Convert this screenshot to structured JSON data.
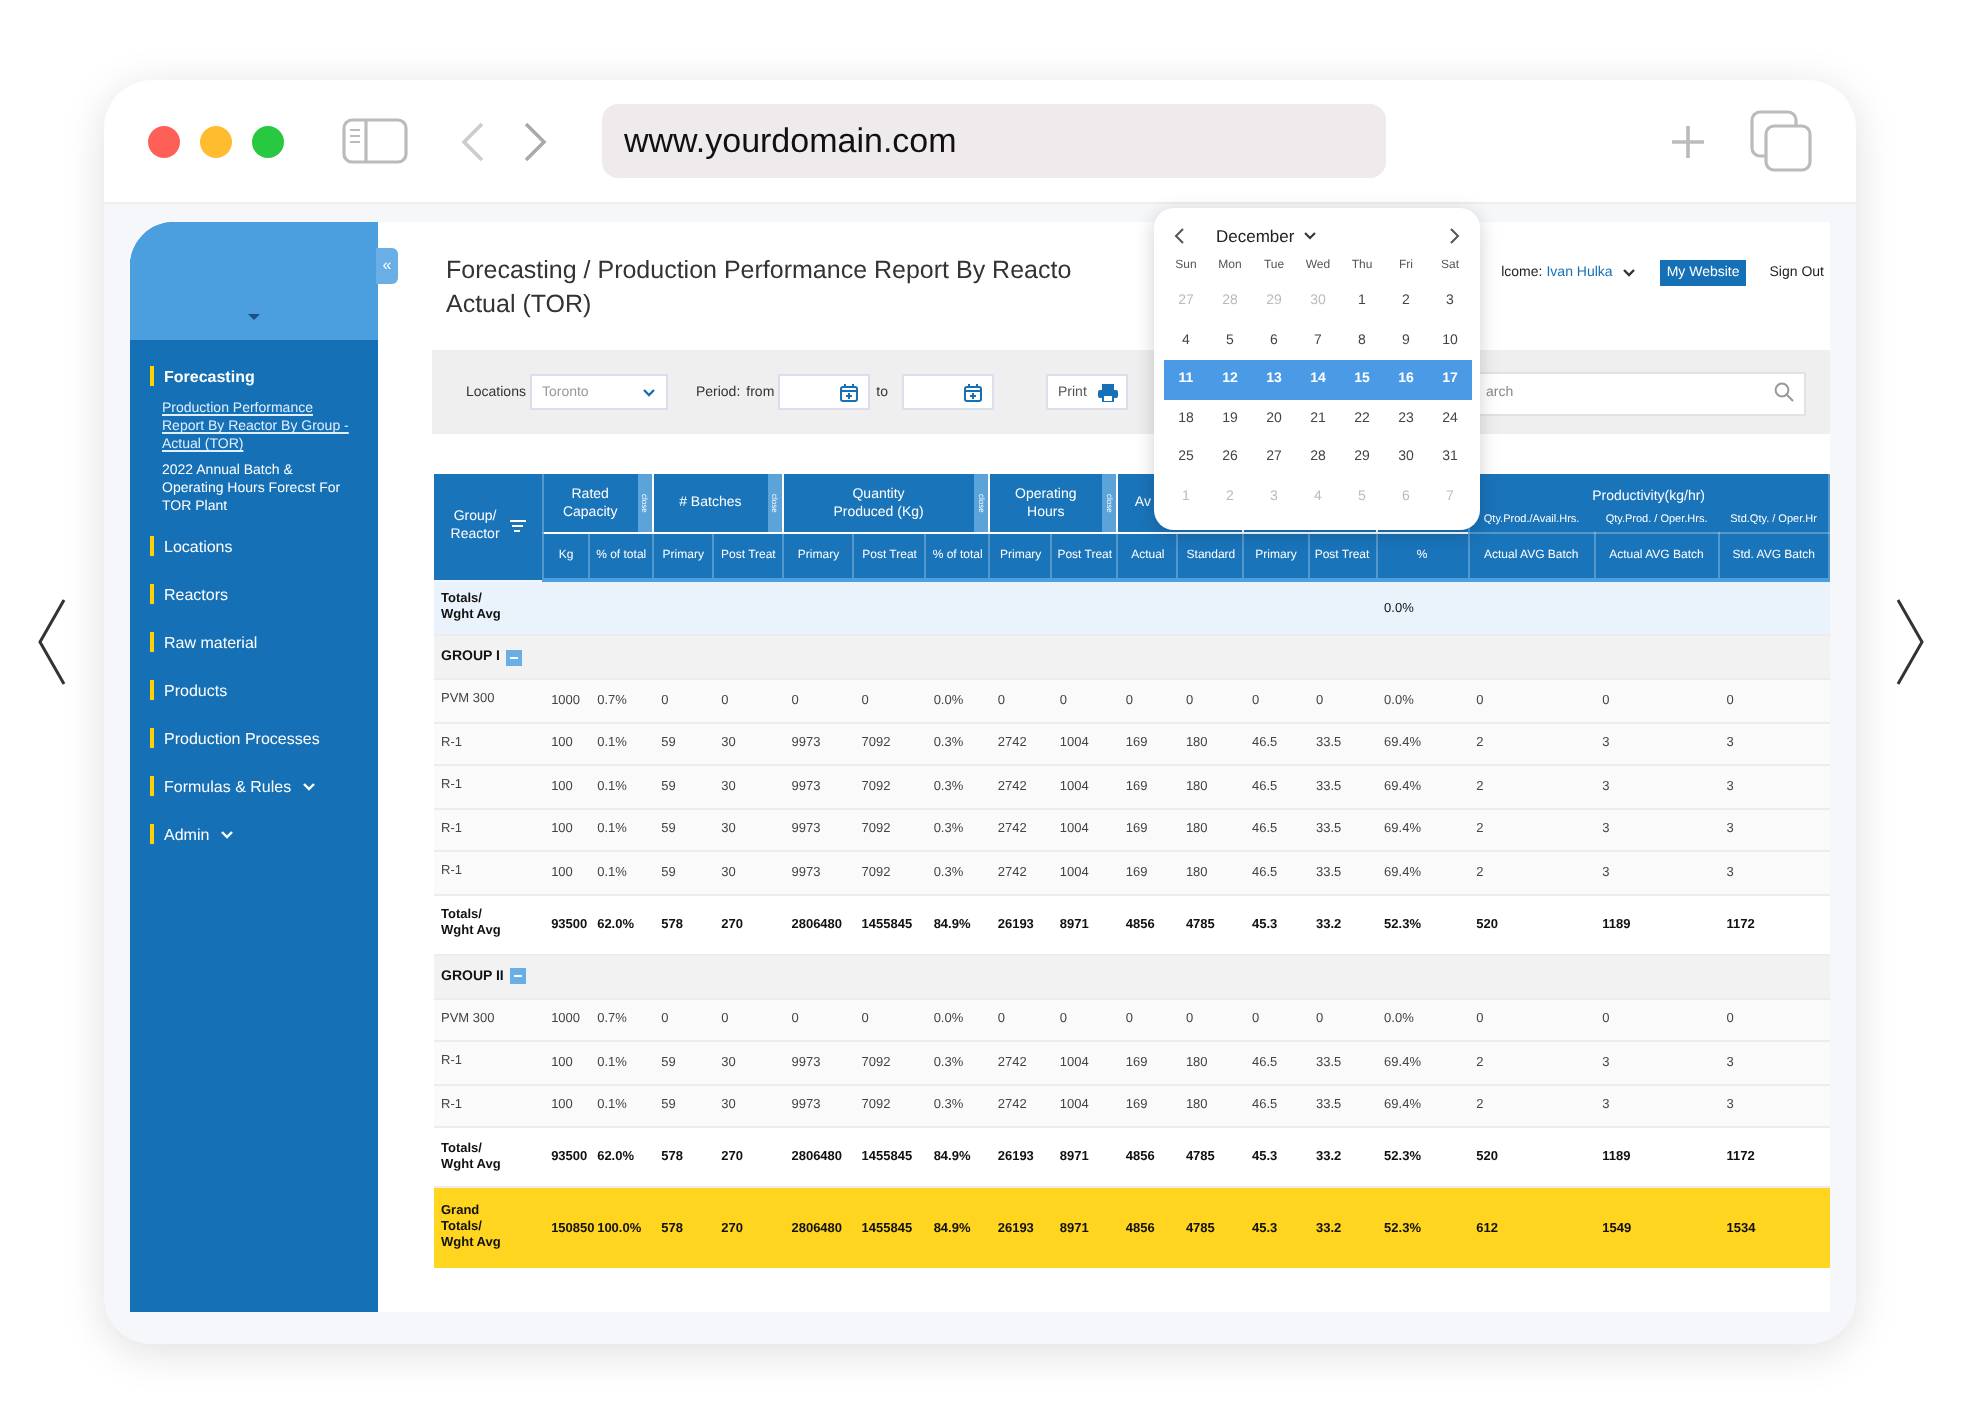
{
  "browser": {
    "url": "www.yourdomain.com"
  },
  "sidebar": {
    "items": [
      {
        "label": "Forecasting",
        "active": true,
        "children": [
          {
            "label": "Production Performance Report By Reactor By Group - Actual (TOR)",
            "selected": true
          },
          {
            "label": "2022 Annual Batch & Operating Hours Forecst For TOR Plant",
            "selected": false
          }
        ]
      },
      {
        "label": "Locations",
        "active": false
      },
      {
        "label": "Reactors",
        "active": false
      },
      {
        "label": "Raw material",
        "active": false
      },
      {
        "label": "Products",
        "active": false
      },
      {
        "label": "Production Processes",
        "active": false
      },
      {
        "label": "Formulas & Rules",
        "active": false,
        "has_menu": true
      },
      {
        "label": "Admin",
        "active": false,
        "has_menu": true
      }
    ]
  },
  "collapse_button": "«",
  "header": {
    "title_lines": [
      "Forecasting / Production Performance Report By Reacto",
      "Actual (TOR)"
    ],
    "welcome_label": "lcome:",
    "user": "Ivan Hulka",
    "my_website": "My Website",
    "sign_out": "Sign Out"
  },
  "toolbar": {
    "location_label": "Locations",
    "location_value": "Toronto",
    "period_label": "Period:",
    "from_label": "from",
    "to_label": "to",
    "print": "Print",
    "search": {
      "placeholder": "arch"
    }
  },
  "calendar": {
    "month": "December",
    "weekdays": [
      "Sun",
      "Mon",
      "Tue",
      "Wed",
      "Thu",
      "Fri",
      "Sat"
    ],
    "weeks": [
      [
        {
          "day": "27",
          "in_month": false,
          "selected": false
        },
        {
          "day": "28",
          "in_month": false,
          "selected": false
        },
        {
          "day": "29",
          "in_month": false,
          "selected": false
        },
        {
          "day": "30",
          "in_month": false,
          "selected": false
        },
        {
          "day": "1",
          "in_month": true,
          "selected": false
        },
        {
          "day": "2",
          "in_month": true,
          "selected": false
        },
        {
          "day": "3",
          "in_month": true,
          "selected": false
        }
      ],
      [
        {
          "day": "4",
          "in_month": true,
          "selected": false
        },
        {
          "day": "5",
          "in_month": true,
          "selected": false
        },
        {
          "day": "6",
          "in_month": true,
          "selected": false
        },
        {
          "day": "7",
          "in_month": true,
          "selected": false
        },
        {
          "day": "8",
          "in_month": true,
          "selected": false
        },
        {
          "day": "9",
          "in_month": true,
          "selected": false
        },
        {
          "day": "10",
          "in_month": true,
          "selected": false
        }
      ],
      [
        {
          "day": "11",
          "in_month": true,
          "selected": true
        },
        {
          "day": "12",
          "in_month": true,
          "selected": true
        },
        {
          "day": "13",
          "in_month": true,
          "selected": true
        },
        {
          "day": "14",
          "in_month": true,
          "selected": true
        },
        {
          "day": "15",
          "in_month": true,
          "selected": true
        },
        {
          "day": "16",
          "in_month": true,
          "selected": true
        },
        {
          "day": "17",
          "in_month": true,
          "selected": true
        }
      ],
      [
        {
          "day": "18",
          "in_month": true,
          "selected": false
        },
        {
          "day": "19",
          "in_month": true,
          "selected": false
        },
        {
          "day": "20",
          "in_month": true,
          "selected": false
        },
        {
          "day": "21",
          "in_month": true,
          "selected": false
        },
        {
          "day": "22",
          "in_month": true,
          "selected": false
        },
        {
          "day": "23",
          "in_month": true,
          "selected": false
        },
        {
          "day": "24",
          "in_month": true,
          "selected": false
        }
      ],
      [
        {
          "day": "25",
          "in_month": true,
          "selected": false
        },
        {
          "day": "26",
          "in_month": true,
          "selected": false
        },
        {
          "day": "27",
          "in_month": true,
          "selected": false
        },
        {
          "day": "28",
          "in_month": true,
          "selected": false
        },
        {
          "day": "29",
          "in_month": true,
          "selected": false
        },
        {
          "day": "30",
          "in_month": true,
          "selected": false
        },
        {
          "day": "31",
          "in_month": true,
          "selected": false
        }
      ],
      [
        {
          "day": "1",
          "in_month": false,
          "selected": false
        },
        {
          "day": "2",
          "in_month": false,
          "selected": false
        },
        {
          "day": "3",
          "in_month": false,
          "selected": false
        },
        {
          "day": "4",
          "in_month": false,
          "selected": false
        },
        {
          "day": "5",
          "in_month": false,
          "selected": false
        },
        {
          "day": "6",
          "in_month": false,
          "selected": false
        },
        {
          "day": "7",
          "in_month": false,
          "selected": false
        }
      ]
    ]
  },
  "table": {
    "header_groups": [
      {
        "kind": "rowhead",
        "label": "Group/\nReactor"
      },
      {
        "kind": "group",
        "label": "Rated\nCapacity",
        "close": "close",
        "subs": [
          "Kg",
          "% of total"
        ]
      },
      {
        "kind": "group",
        "label": "# Batches",
        "close": "close",
        "subs": [
          "Primary",
          "Post Treat"
        ]
      },
      {
        "kind": "group",
        "label": "Quantity\nProduced (Kg)",
        "close": "close",
        "subs": [
          "Primary",
          "Post Treat",
          "% of total"
        ]
      },
      {
        "kind": "group",
        "label": "Operating\nHours",
        "close": "close",
        "subs": [
          "Primary",
          "Post Treat"
        ]
      },
      {
        "kind": "partial",
        "label": "Av",
        "subs": [
          "Actual",
          "Standard"
        ]
      },
      {
        "kind": "group",
        "subs": [
          "Primary",
          "Post Treat"
        ]
      },
      {
        "kind": "group",
        "subs": [
          "%"
        ]
      },
      {
        "kind": "notes",
        "label": "Productivity(kg/hr)",
        "notes": [
          "Qty.Prod./Avail.Hrs.",
          "Qty.Prod. / Oper.Hrs.",
          "Std.Qty. / Oper.Hr"
        ],
        "subs": [
          "Actual AVG Batch",
          "Actual AVG Batch",
          "Std. AVG Batch"
        ]
      }
    ],
    "rows": [
      {
        "kind": "summary",
        "label": "Totals/\nWght Avg",
        "cells": [
          null,
          null,
          null,
          null,
          null,
          null,
          null,
          null,
          null,
          null,
          null,
          null,
          null,
          "0.0%",
          null,
          null,
          null
        ]
      },
      {
        "kind": "group",
        "label": "GROUP I",
        "expanded": true
      },
      {
        "kind": "data",
        "label": "PVM 300",
        "cells": [
          "1000",
          "0.7%",
          "0",
          "0",
          "0",
          "0",
          "0.0%",
          "0",
          "0",
          "0",
          "0",
          "0",
          "0",
          "0.0%",
          "0",
          "0",
          "0"
        ]
      },
      {
        "kind": "data",
        "label": "R-1",
        "cells": [
          "100",
          "0.1%",
          "59",
          "30",
          "9973",
          "7092",
          "0.3%",
          "2742",
          "1004",
          "169",
          "180",
          "46.5",
          "33.5",
          "69.4%",
          "2",
          "3",
          "3"
        ]
      },
      {
        "kind": "data",
        "label": "R-1",
        "cells": [
          "100",
          "0.1%",
          "59",
          "30",
          "9973",
          "7092",
          "0.3%",
          "2742",
          "1004",
          "169",
          "180",
          "46.5",
          "33.5",
          "69.4%",
          "2",
          "3",
          "3"
        ]
      },
      {
        "kind": "data",
        "label": "R-1",
        "cells": [
          "100",
          "0.1%",
          "59",
          "30",
          "9973",
          "7092",
          "0.3%",
          "2742",
          "1004",
          "169",
          "180",
          "46.5",
          "33.5",
          "69.4%",
          "2",
          "3",
          "3"
        ]
      },
      {
        "kind": "data",
        "label": "R-1",
        "cells": [
          "100",
          "0.1%",
          "59",
          "30",
          "9973",
          "7092",
          "0.3%",
          "2742",
          "1004",
          "169",
          "180",
          "46.5",
          "33.5",
          "69.4%",
          "2",
          "3",
          "3"
        ]
      },
      {
        "kind": "subtotal",
        "label": "Totals/\nWght Avg",
        "cells": [
          "93500",
          "62.0%",
          "578",
          "270",
          "2806480",
          "1455845",
          "84.9%",
          "26193",
          "8971",
          "4856",
          "4785",
          "45.3",
          "33.2",
          "52.3%",
          "520",
          "1189",
          "1172"
        ]
      },
      {
        "kind": "group",
        "label": "GROUP II",
        "expanded": true
      },
      {
        "kind": "data",
        "label": "PVM 300",
        "cells": [
          "1000",
          "0.7%",
          "0",
          "0",
          "0",
          "0",
          "0.0%",
          "0",
          "0",
          "0",
          "0",
          "0",
          "0",
          "0.0%",
          "0",
          "0",
          "0"
        ]
      },
      {
        "kind": "data",
        "label": "R-1",
        "cells": [
          "100",
          "0.1%",
          "59",
          "30",
          "9973",
          "7092",
          "0.3%",
          "2742",
          "1004",
          "169",
          "180",
          "46.5",
          "33.5",
          "69.4%",
          "2",
          "3",
          "3"
        ]
      },
      {
        "kind": "data",
        "label": "R-1",
        "cells": [
          "100",
          "0.1%",
          "59",
          "30",
          "9973",
          "7092",
          "0.3%",
          "2742",
          "1004",
          "169",
          "180",
          "46.5",
          "33.5",
          "69.4%",
          "2",
          "3",
          "3"
        ]
      },
      {
        "kind": "subtotal",
        "label": "Totals/\nWght Avg",
        "cells": [
          "93500",
          "62.0%",
          "578",
          "270",
          "2806480",
          "1455845",
          "84.9%",
          "26193",
          "8971",
          "4856",
          "4785",
          "45.3",
          "33.2",
          "52.3%",
          "520",
          "1189",
          "1172"
        ]
      },
      {
        "kind": "grand",
        "label": "Grand\nTotals/\nWght Avg",
        "cells": [
          "150850",
          "100.0%",
          "578",
          "270",
          "2806480",
          "1455845",
          "84.9%",
          "26193",
          "8971",
          "4856",
          "4785",
          "45.3",
          "33.2",
          "52.3%",
          "612",
          "1549",
          "1534"
        ]
      }
    ]
  }
}
